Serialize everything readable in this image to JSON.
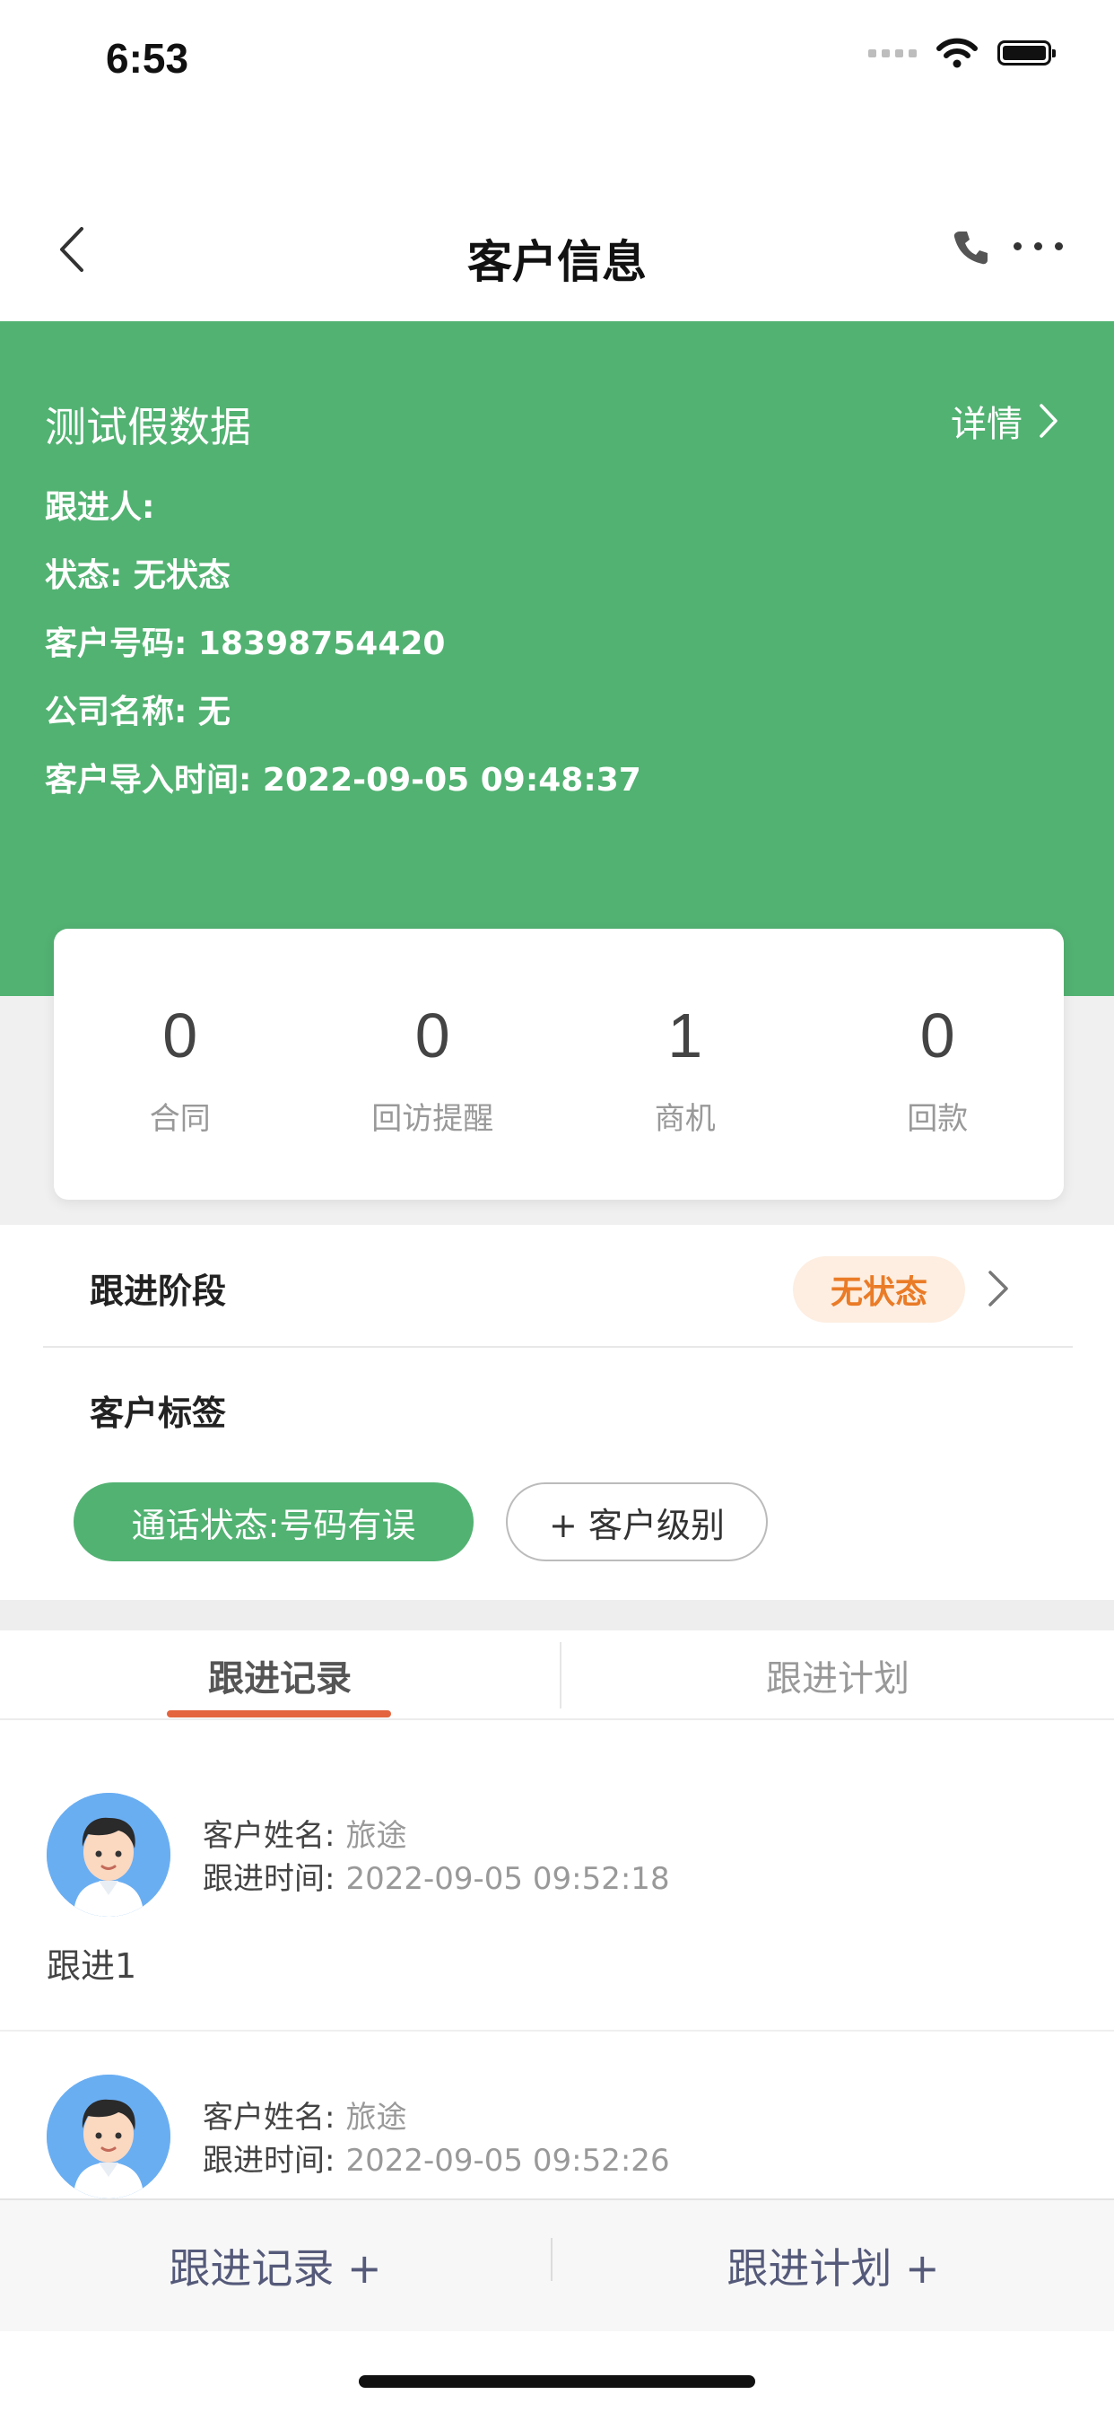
{
  "status_bar": {
    "time": "6:53"
  },
  "nav": {
    "title": "客户信息"
  },
  "customer": {
    "name": "测试假数据",
    "detail_label": "详情",
    "follower": "跟进人:",
    "status": "状态: 无状态",
    "phone": "客户号码: 18398754420",
    "company": "公司名称: 无",
    "import_time": "客户导入时间: 2022-09-05 09:48:37"
  },
  "stats": [
    {
      "value": "0",
      "label": "合同"
    },
    {
      "value": "0",
      "label": "回访提醒"
    },
    {
      "value": "1",
      "label": "商机"
    },
    {
      "value": "0",
      "label": "回款"
    }
  ],
  "stage": {
    "label": "跟进阶段",
    "value": "无状态"
  },
  "tags": {
    "label": "客户标签",
    "items": [
      "通话状态:号码有误"
    ],
    "add_label": "+ 客户级别"
  },
  "tabs": [
    {
      "label": "跟进记录",
      "active": true
    },
    {
      "label": "跟进计划",
      "active": false
    }
  ],
  "records": [
    {
      "name_key": "客户姓名:",
      "name_val": "旅途",
      "time_key": "跟进时间:",
      "time_val": "2022-09-05 09:52:18",
      "content": "跟进1"
    },
    {
      "name_key": "客户姓名:",
      "name_val": "旅途",
      "time_key": "跟进时间:",
      "time_val": "2022-09-05 09:52:26",
      "content": ""
    }
  ],
  "bottom": {
    "add_record": "跟进记录 +",
    "add_plan": "跟进计划 +"
  },
  "colors": {
    "green": "#52b272",
    "orange": "#ea7b27",
    "tab_underline": "#e3643e"
  }
}
